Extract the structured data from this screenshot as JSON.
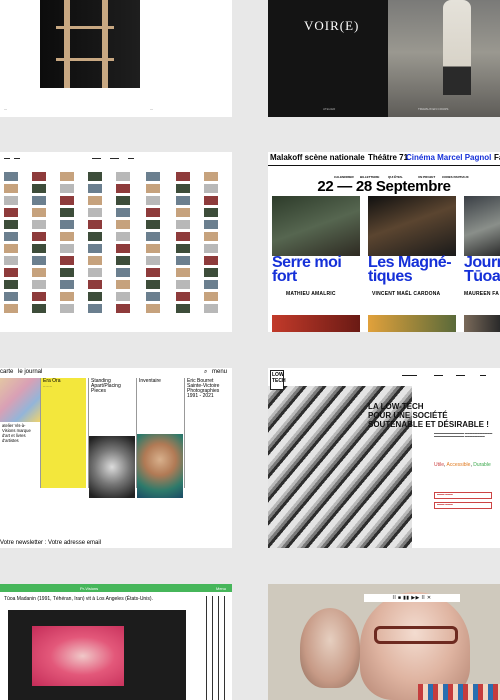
{
  "tiles": {
    "voir": {
      "logo": "VOIR(E)",
      "foot_left": "ATELIER",
      "foot_right": "TRAVAUX EN COURS"
    },
    "malakoff": {
      "brand1": "Malakoff scène nationale",
      "brand2": "Théâtre 71",
      "brand3": "Cinéma Marcel Pagnol",
      "brand4": "Fa",
      "menu": [
        "CALENDRIER",
        "BILLETTERIE",
        "QUI ÊTES-",
        "UN PROJET",
        "CODES PARTIAUX"
      ],
      "dates": "22 — 28 Septembre",
      "films": [
        {
          "title_line1": "Serre moi",
          "title_line2": "fort",
          "director": "MATHIEU AMALRIC"
        },
        {
          "title_line1": "Les Magné-",
          "title_line2": "tiques",
          "director": "VINCENT MAËL CARDONA"
        },
        {
          "title_line1": "Journ",
          "title_line2": "Tūoa",
          "director": "MAUREEN FA"
        }
      ]
    },
    "journal": {
      "nav_carte": "carte",
      "nav_journal": "le journal",
      "nav_menu": "menu",
      "search_icon": "search-icon",
      "cards": [
        {
          "title": "Era Ora"
        },
        {
          "title": "Standing Apart/Placing Pieces"
        },
        {
          "title": "Inventaire"
        },
        {
          "title": "Eric Bourret Sainte-Victoire Photographies 1991 - 2021"
        }
      ],
      "left_title": "atelier Vis-à-Visions marque d'art et livres d'artistes",
      "newsletter": "Votre newsletter : Votre adresse email"
    },
    "lowtech": {
      "badge": "LOW TECH",
      "headline_line1": "LA LOW-TECH",
      "headline_line2": "POUR UNE SOCIÉTÉ",
      "headline_line3": "SOUTENABLE ET DÉSIRABLE !",
      "util_utile": "Utile",
      "util_accessible": "Accessible",
      "util_durable": "Durable"
    },
    "video": {
      "bar_left": "Pr-Visions",
      "bar_right": "Menu",
      "caption": "Tūoa Madanin (1991, Téhéran, Iran) vit à Los Angeles (États-Unis)."
    },
    "portrait": {
      "player": "II ■ ▮▮ ▶▶ II ✕"
    }
  },
  "colors": {
    "malakoff_blue": "#1530d8",
    "journal_yellow": "#f3e73c",
    "lowtech_red": "#c44",
    "lowtech_orange": "#e07a1f",
    "lowtech_green": "#3aa84b",
    "video_green": "#46b65a"
  }
}
